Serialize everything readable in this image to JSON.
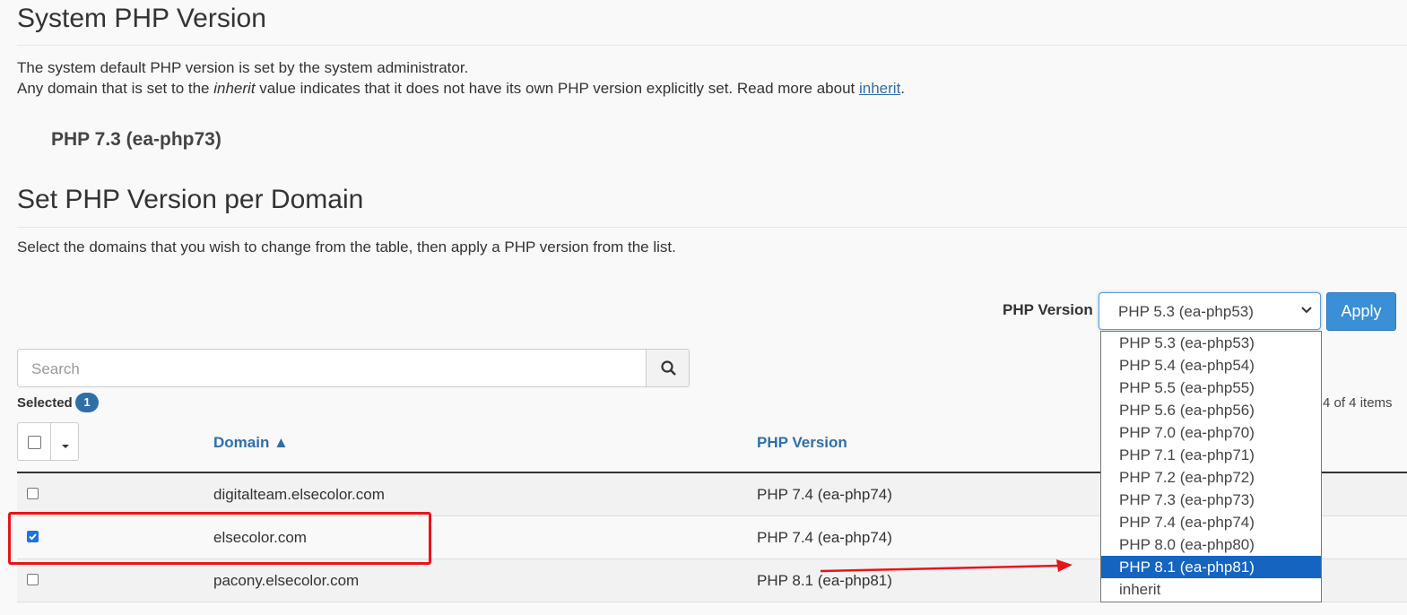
{
  "system_section": {
    "title": "System PHP Version",
    "line1": "The system default PHP version is set by the system administrator.",
    "line2_prefix": "Any domain that is set to the ",
    "line2_em": "inherit",
    "line2_middle": " value indicates that it does not have its own PHP version explicitly set. Read more about ",
    "line2_link": "inherit",
    "line2_suffix": ".",
    "current_version": "PHP 7.3 (ea-php73)"
  },
  "domain_section": {
    "title": "Set PHP Version per Domain",
    "description": "Select the domains that you wish to change from the table, then apply a PHP version from the list."
  },
  "toolbar": {
    "php_version_label": "PHP Version",
    "selected_value": "PHP 5.3 (ea-php53)",
    "apply_label": "Apply"
  },
  "dropdown": {
    "options": [
      "PHP 5.3 (ea-php53)",
      "PHP 5.4 (ea-php54)",
      "PHP 5.5 (ea-php55)",
      "PHP 5.6 (ea-php56)",
      "PHP 7.0 (ea-php70)",
      "PHP 7.1 (ea-php71)",
      "PHP 7.2 (ea-php72)",
      "PHP 7.3 (ea-php73)",
      "PHP 7.4 (ea-php74)",
      "PHP 8.0 (ea-php80)",
      "PHP 8.1 (ea-php81)",
      "inherit"
    ],
    "highlighted_index": 10
  },
  "search": {
    "placeholder": "Search"
  },
  "selection": {
    "label": "Selected",
    "count": "1",
    "items_text": "4 of 4 items"
  },
  "table": {
    "columns": {
      "domain": "Domain ▲",
      "php_version": "PHP Version"
    },
    "rows": [
      {
        "domain": "digitalteam.elsecolor.com",
        "php_version": "PHP 7.4 (ea-php74)",
        "checked": false
      },
      {
        "domain": "elsecolor.com",
        "php_version": "PHP 7.4 (ea-php74)",
        "checked": true
      },
      {
        "domain": "pacony.elsecolor.com",
        "php_version": "PHP 8.1 (ea-php81)",
        "checked": false
      }
    ]
  },
  "colors": {
    "accent": "#2f6fa7",
    "button": "#3a8fd6",
    "highlight": "#1565c0",
    "annotation": "#e8141b"
  }
}
